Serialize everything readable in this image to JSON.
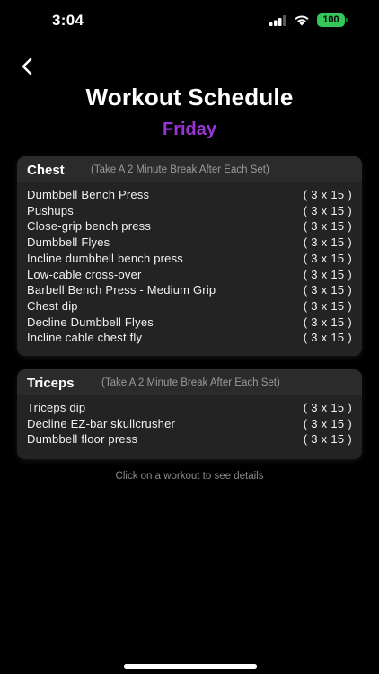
{
  "status": {
    "time": "3:04",
    "battery": "100"
  },
  "header": {
    "title": "Workout Schedule",
    "day": "Friday"
  },
  "sections": [
    {
      "name": "Chest",
      "note": "(Take A 2 Minute Break After Each Set)",
      "exercises": [
        {
          "name": "Dumbbell Bench Press",
          "sets": "( 3 x 15 )"
        },
        {
          "name": "Pushups",
          "sets": "( 3 x 15 )"
        },
        {
          "name": "Close-grip bench press",
          "sets": "( 3 x 15 )"
        },
        {
          "name": "Dumbbell Flyes",
          "sets": "( 3 x 15 )"
        },
        {
          "name": "Incline dumbbell bench press",
          "sets": "( 3 x 15 )"
        },
        {
          "name": "Low-cable cross-over",
          "sets": "( 3 x 15 )"
        },
        {
          "name": "Barbell Bench Press - Medium Grip",
          "sets": "( 3 x 15 )"
        },
        {
          "name": "Chest dip",
          "sets": "( 3 x 15 )"
        },
        {
          "name": "Decline Dumbbell Flyes",
          "sets": "( 3 x 15 )"
        },
        {
          "name": "Incline cable chest fly",
          "sets": "( 3 x 15 )"
        }
      ]
    },
    {
      "name": "Triceps",
      "note": "(Take A 2 Minute Break After Each Set)",
      "exercises": [
        {
          "name": "Triceps dip",
          "sets": "( 3 x 15 )"
        },
        {
          "name": "Decline EZ-bar skullcrusher",
          "sets": "( 3 x 15 )"
        },
        {
          "name": "Dumbbell floor press",
          "sets": "( 3 x 15 )"
        }
      ]
    }
  ],
  "hint": "Click on a workout to see details",
  "icons": {
    "back": "chevron-left-icon",
    "signal": "cellular-signal-icon",
    "wifi": "wifi-icon",
    "battery": "battery-icon"
  },
  "colors": {
    "accent": "#9b34d6",
    "battery": "#34c759",
    "card": "#232323",
    "background": "#000000"
  }
}
